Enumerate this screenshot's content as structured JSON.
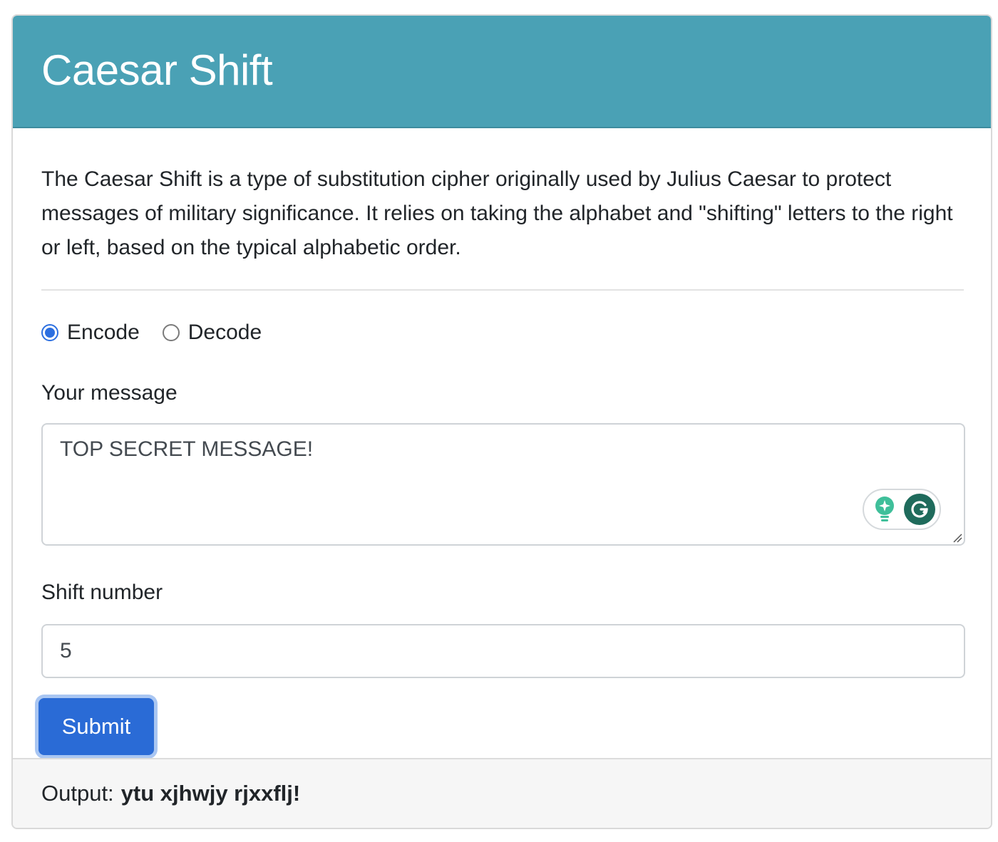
{
  "header": {
    "title": "Caesar Shift"
  },
  "intro": {
    "text": "The Caesar Shift is a type of substitution cipher originally used by Julius Caesar to protect messages of military significance. It relies on taking the alphabet and \"shifting\" letters to the right or left, based on the typical alphabetic order."
  },
  "mode": {
    "options": [
      {
        "label": "Encode",
        "checked": true
      },
      {
        "label": "Decode",
        "checked": false
      }
    ]
  },
  "message": {
    "label": "Your message",
    "value": "TOP SECRET MESSAGE!"
  },
  "shift": {
    "label": "Shift number",
    "value": "5"
  },
  "submit": {
    "label": "Submit"
  },
  "output": {
    "label": "Output:",
    "value": "ytu xjhwjy rjxxflj!"
  },
  "colors": {
    "header_bg": "#4aa1b5",
    "primary": "#2a6bd6",
    "footer_bg": "#f6f6f6"
  },
  "icons": {
    "grammarly_assist": "lightbulb-sparkle-icon",
    "grammarly_logo": "grammarly-icon"
  }
}
